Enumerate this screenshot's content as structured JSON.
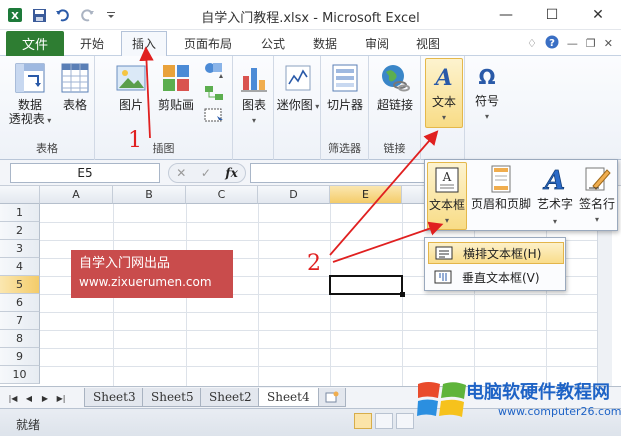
{
  "window": {
    "title": "自学入门教程.xlsx - Microsoft Excel",
    "controls": {
      "minimize": "—",
      "maximize": "☐",
      "close": "✕"
    }
  },
  "tabs": {
    "file": "文件",
    "items": [
      "开始",
      "插入",
      "页面布局",
      "公式",
      "数据",
      "审阅",
      "视图"
    ],
    "active": "插入"
  },
  "ribbon": {
    "groups": {
      "tables": {
        "label": "表格",
        "pivot_line1": "数据",
        "pivot_line2": "透视表",
        "table": "表格"
      },
      "illustrations": {
        "label": "插图",
        "picture": "图片",
        "clipart": "剪贴画"
      },
      "charts": {
        "chart": "图表"
      },
      "sparklines": {
        "sparkline": "迷你图"
      },
      "filter": {
        "label": "筛选器",
        "slicer": "切片器"
      },
      "links": {
        "label": "链接",
        "hyperlink": "超链接"
      },
      "text": {
        "text": "文本"
      },
      "symbols": {
        "symbol": "符号"
      }
    }
  },
  "formula_bar": {
    "name_box": "E5",
    "fx": "fx"
  },
  "grid": {
    "columns": [
      "A",
      "B",
      "C",
      "D",
      "E"
    ],
    "rows": [
      "1",
      "2",
      "3",
      "4",
      "5",
      "6",
      "7",
      "8",
      "9",
      "10"
    ],
    "selected_col": "E",
    "selected_row": "5"
  },
  "watermark": {
    "line1": "自学入门网出品",
    "line2": "www.zixuerumen.com"
  },
  "text_panel": {
    "textbox": "文本框",
    "header_footer": "页眉和页脚",
    "wordart": "艺术字",
    "signature": "签名行"
  },
  "textbox_menu": {
    "horizontal": "横排文本框(H)",
    "vertical": "垂直文本框(V)"
  },
  "sheets": [
    "Sheet3",
    "Sheet5",
    "Sheet2",
    "Sheet4"
  ],
  "active_sheet": "Sheet4",
  "status": {
    "ready": "就绪"
  },
  "brand": {
    "name": "电脑软硬件教程网",
    "url": "www.computer26.com"
  },
  "annotations": {
    "step1": "1",
    "step2": "2"
  },
  "colors": {
    "accent_red": "#e02020",
    "file_tab": "#2e7d32",
    "brand_blue": "#1e63c6"
  }
}
